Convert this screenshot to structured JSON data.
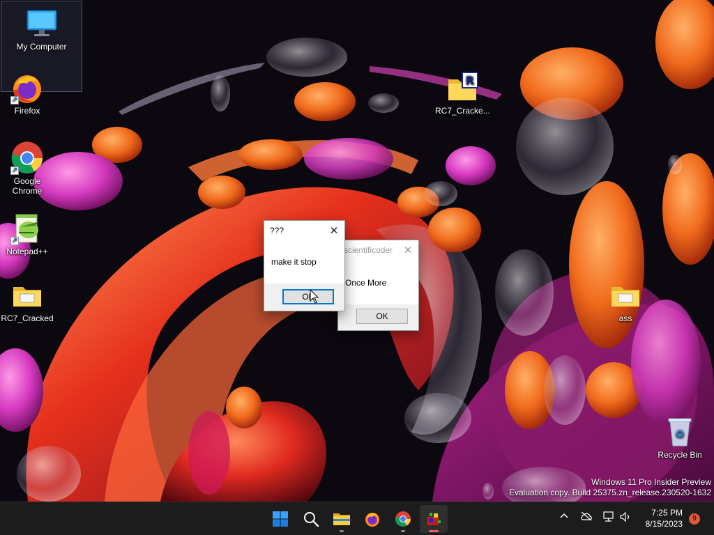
{
  "desktop": {
    "icons": [
      {
        "label": "My Computer",
        "icon": "monitor-icon"
      },
      {
        "label": "Firefox",
        "icon": "firefox-icon"
      },
      {
        "label": "Google Chrome",
        "icon": "chrome-icon"
      },
      {
        "label": "Notepad++",
        "icon": "notepadpp-icon"
      },
      {
        "label": "RC7_Cracked",
        "icon": "folder-icon"
      },
      {
        "label": "RC7_Cracke...",
        "icon": "folder-r-icon"
      },
      {
        "label": "ass",
        "icon": "folder-icon"
      },
      {
        "label": "Recycle Bin",
        "icon": "recycle-bin-icon"
      }
    ]
  },
  "dialogs": {
    "front": {
      "title": "???",
      "message": "make it stop",
      "button_label": "OK",
      "close_glyph": "✕"
    },
    "back": {
      "title": "scientificoder",
      "message": "Once More",
      "button_label": "OK",
      "close_glyph": "✕"
    }
  },
  "watermark": {
    "line1": "Windows 11 Pro Insider Preview",
    "line2": "Evaluation copy. Build 25375.zn_release.230520-1632"
  },
  "taskbar": {
    "apps": [
      "start-icon",
      "search-icon",
      "file-explorer-icon",
      "firefox-icon",
      "chrome-icon",
      "app-icon"
    ],
    "tray": {
      "time": "7:25 PM",
      "date": "8/15/2023",
      "notification_count": "9"
    }
  },
  "colors": {
    "accent": "#0078d4",
    "taskbar": "#1c1c1c",
    "badge": "#e05a37"
  }
}
